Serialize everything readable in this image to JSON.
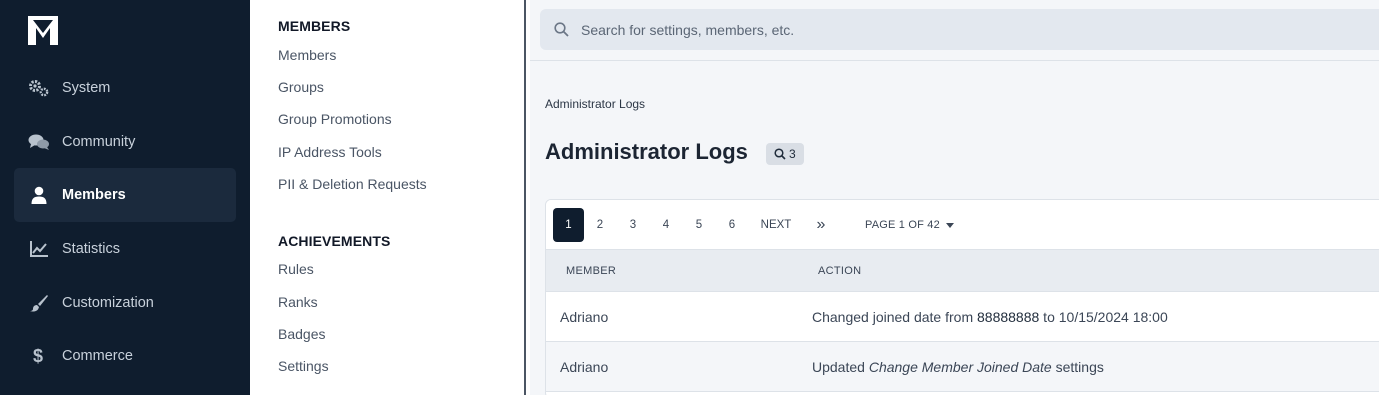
{
  "nav": {
    "items": [
      {
        "label": "System",
        "icon": "gears-icon",
        "active": false
      },
      {
        "label": "Community",
        "icon": "chat-bubbles-icon",
        "active": false
      },
      {
        "label": "Members",
        "icon": "user-icon",
        "active": true
      },
      {
        "label": "Statistics",
        "icon": "line-chart-icon",
        "active": false
      },
      {
        "label": "Customization",
        "icon": "brush-icon",
        "active": false
      },
      {
        "label": "Commerce",
        "icon": "dollar-icon",
        "active": false
      }
    ]
  },
  "submenu": {
    "sections": [
      {
        "heading": "MEMBERS",
        "links": [
          "Members",
          "Groups",
          "Group Promotions",
          "IP Address Tools",
          "PII & Deletion Requests"
        ]
      },
      {
        "heading": "ACHIEVEMENTS",
        "links": [
          "Rules",
          "Ranks",
          "Badges",
          "Settings"
        ]
      }
    ]
  },
  "search": {
    "placeholder": "Search for settings, members, etc."
  },
  "breadcrumb": "Administrator Logs",
  "page": {
    "title": "Administrator Logs",
    "badge_count": "3"
  },
  "pagination": {
    "pages": [
      "1",
      "2",
      "3",
      "4",
      "5",
      "6"
    ],
    "current": "1",
    "next_label": "NEXT",
    "last_symbol": "»",
    "page_label": "PAGE 1 OF 42"
  },
  "table": {
    "columns": [
      "MEMBER",
      "ACTION"
    ],
    "rows": [
      {
        "member": "Adriano",
        "action_prefix": "Changed joined date from ",
        "action_value": "88888888",
        "action_mid": " to 10/15/2024 18:00",
        "action_suffix": ""
      },
      {
        "member": "Adriano",
        "action_prefix": "Updated ",
        "action_value": "Change Member Joined Date",
        "action_mid": "",
        "action_suffix": " settings"
      }
    ]
  },
  "colors": {
    "nav_bg": "#0f1d2e",
    "nav_active": "#1b2a3d",
    "accent": "#0f1d2e"
  }
}
